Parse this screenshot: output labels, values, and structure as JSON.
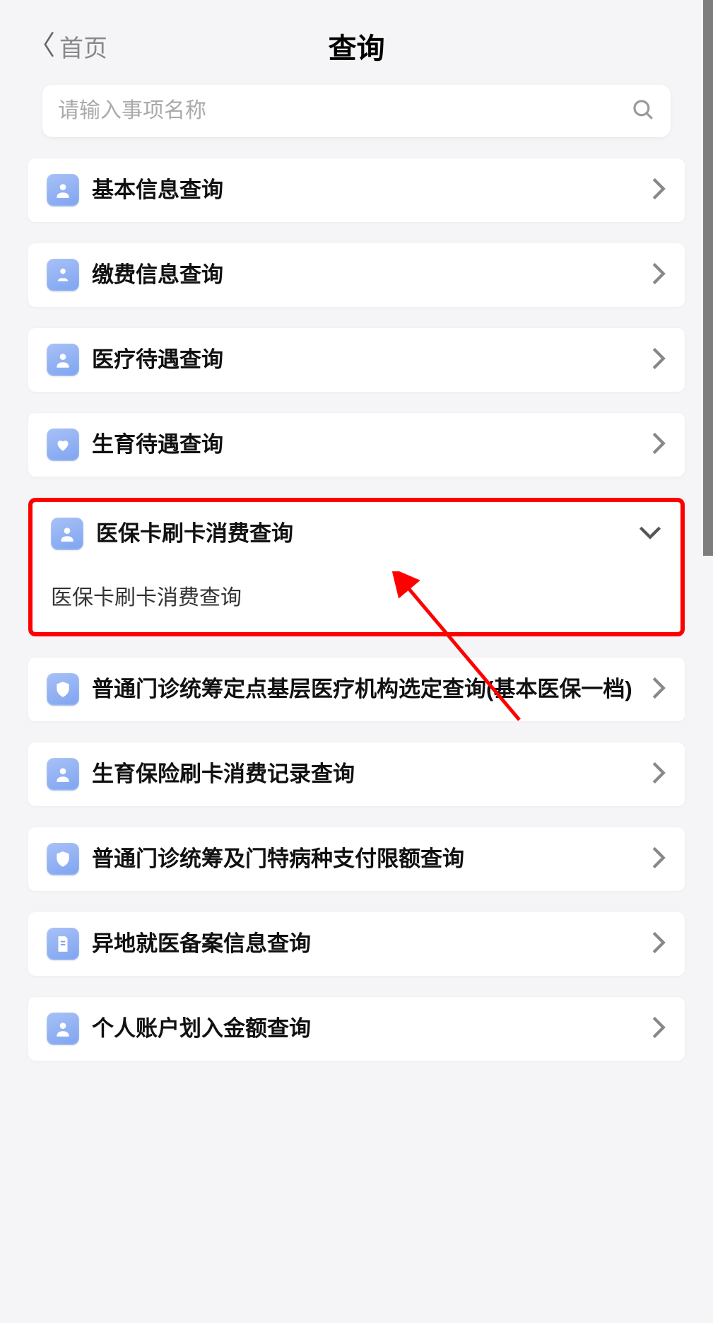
{
  "header": {
    "back_label": "首页",
    "title": "查询"
  },
  "search": {
    "placeholder": "请输入事项名称"
  },
  "items": [
    {
      "label": "基本信息查询",
      "icon": "person"
    },
    {
      "label": "缴费信息查询",
      "icon": "hand"
    },
    {
      "label": "医疗待遇查询",
      "icon": "person"
    },
    {
      "label": "生育待遇查询",
      "icon": "heart-hands"
    }
  ],
  "expanded_item": {
    "label": "医保卡刷卡消费查询",
    "icon": "person",
    "sub_label": "医保卡刷卡消费查询"
  },
  "items_after": [
    {
      "label": "普通门诊统筹定点基层医疗机构选定查询(基本医保一档)",
      "icon": "shield"
    },
    {
      "label": "生育保险刷卡消费记录查询",
      "icon": "person"
    },
    {
      "label": "普通门诊统筹及门特病种支付限额查询",
      "icon": "shield"
    },
    {
      "label": "异地就医备案信息查询",
      "icon": "doc"
    },
    {
      "label": "个人账户划入金额查询",
      "icon": "person"
    }
  ],
  "annotation": {
    "highlight_color": "#ff0000"
  }
}
